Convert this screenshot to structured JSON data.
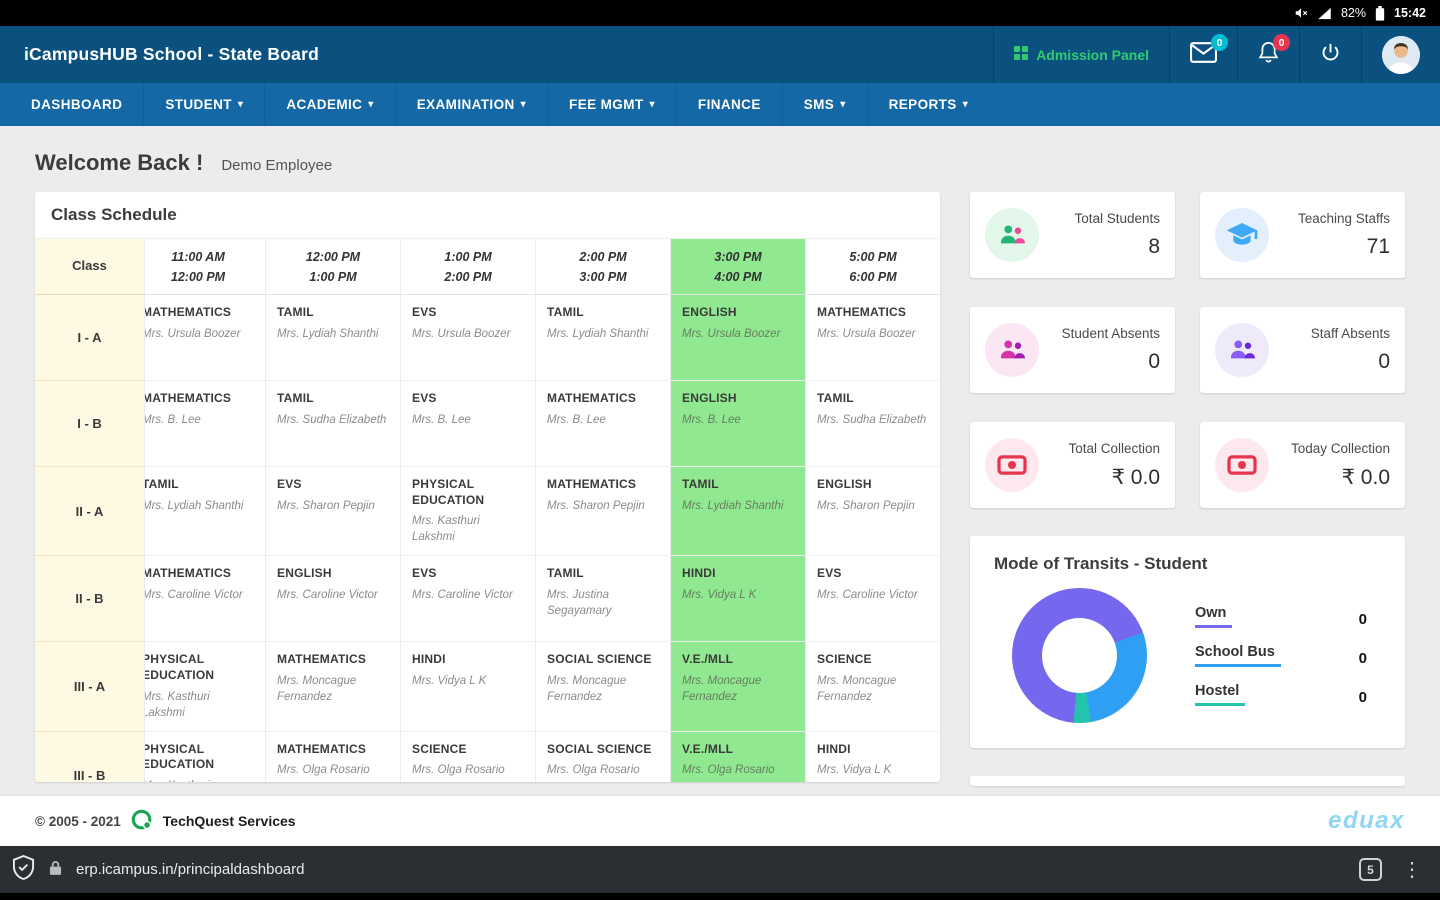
{
  "status_bar": {
    "battery": "82%",
    "time": "15:42"
  },
  "header": {
    "title": "iCampusHUB School - State Board",
    "admission_panel": "Admission Panel",
    "badges": {
      "messages": "0",
      "notifications": "0"
    },
    "accent_green": "#2ecc71"
  },
  "nav": {
    "items": [
      {
        "label": "DASHBOARD",
        "dropdown": false
      },
      {
        "label": "STUDENT",
        "dropdown": true
      },
      {
        "label": "ACADEMIC",
        "dropdown": true
      },
      {
        "label": "EXAMINATION",
        "dropdown": true
      },
      {
        "label": "FEE MGMT",
        "dropdown": true
      },
      {
        "label": "FINANCE",
        "dropdown": false
      },
      {
        "label": "SMS",
        "dropdown": true
      },
      {
        "label": "REPORTS",
        "dropdown": true
      }
    ]
  },
  "welcome": {
    "title": "Welcome Back !",
    "user": "Demo Employee"
  },
  "schedule": {
    "title": "Class Schedule",
    "class_header": "Class",
    "highlight_slot_index": 4,
    "highlight_color": "#90e890",
    "time_slots": [
      [
        "11:00 AM",
        "12:00 PM"
      ],
      [
        "12:00 PM",
        "1:00 PM"
      ],
      [
        "1:00 PM",
        "2:00 PM"
      ],
      [
        "2:00 PM",
        "3:00 PM"
      ],
      [
        "3:00 PM",
        "4:00 PM"
      ],
      [
        "5:00 PM",
        "6:00 PM"
      ]
    ],
    "rows": [
      {
        "class": "I - A",
        "periods": [
          {
            "subject": "MATHEMATICS",
            "teacher": "Mrs. Ursula Boozer"
          },
          {
            "subject": "TAMIL",
            "teacher": "Mrs. Lydiah Shanthi"
          },
          {
            "subject": "EVS",
            "teacher": "Mrs. Ursula Boozer"
          },
          {
            "subject": "TAMIL",
            "teacher": "Mrs. Lydiah Shanthi"
          },
          {
            "subject": "ENGLISH",
            "teacher": "Mrs. Ursula Boozer"
          },
          {
            "subject": "MATHEMATICS",
            "teacher": "Mrs. Ursula Boozer"
          }
        ]
      },
      {
        "class": "I - B",
        "periods": [
          {
            "subject": "MATHEMATICS",
            "teacher": "Mrs. B. Lee"
          },
          {
            "subject": "TAMIL",
            "teacher": "Mrs. Sudha Elizabeth"
          },
          {
            "subject": "EVS",
            "teacher": "Mrs. B. Lee"
          },
          {
            "subject": "MATHEMATICS",
            "teacher": "Mrs. B. Lee"
          },
          {
            "subject": "ENGLISH",
            "teacher": "Mrs. B. Lee"
          },
          {
            "subject": "TAMIL",
            "teacher": "Mrs. Sudha Elizabeth"
          }
        ]
      },
      {
        "class": "II - A",
        "periods": [
          {
            "subject": "TAMIL",
            "teacher": "Mrs. Lydiah Shanthi"
          },
          {
            "subject": "EVS",
            "teacher": "Mrs. Sharon Pepjin"
          },
          {
            "subject": "PHYSICAL EDUCATION",
            "teacher": "Mrs. Kasthuri Lakshmi"
          },
          {
            "subject": "MATHEMATICS",
            "teacher": "Mrs. Sharon Pepjin"
          },
          {
            "subject": "TAMIL",
            "teacher": "Mrs. Lydiah Shanthi"
          },
          {
            "subject": "ENGLISH",
            "teacher": "Mrs. Sharon Pepjin"
          }
        ]
      },
      {
        "class": "II - B",
        "periods": [
          {
            "subject": "MATHEMATICS",
            "teacher": "Mrs. Caroline Victor"
          },
          {
            "subject": "ENGLISH",
            "teacher": "Mrs. Caroline Victor"
          },
          {
            "subject": "EVS",
            "teacher": "Mrs. Caroline Victor"
          },
          {
            "subject": "TAMIL",
            "teacher": "Mrs. Justina Segayamary"
          },
          {
            "subject": "HINDI",
            "teacher": "Mrs. Vidya L K"
          },
          {
            "subject": "EVS",
            "teacher": "Mrs. Caroline Victor"
          }
        ]
      },
      {
        "class": "III - A",
        "periods": [
          {
            "subject": "PHYSICAL EDUCATION",
            "teacher": "Mrs. Kasthuri Lakshmi"
          },
          {
            "subject": "MATHEMATICS",
            "teacher": "Mrs. Moncague Fernandez"
          },
          {
            "subject": "HINDI",
            "teacher": "Mrs. Vidya L K"
          },
          {
            "subject": "SOCIAL SCIENCE",
            "teacher": "Mrs. Moncague Fernandez"
          },
          {
            "subject": "V.E./MLL",
            "teacher": "Mrs. Moncague Fernandez"
          },
          {
            "subject": "SCIENCE",
            "teacher": "Mrs. Moncague Fernandez"
          }
        ]
      },
      {
        "class": "III - B",
        "periods": [
          {
            "subject": "PHYSICAL EDUCATION",
            "teacher": "Mrs. Kasthuri Lakshmi"
          },
          {
            "subject": "MATHEMATICS",
            "teacher": "Mrs. Olga Rosario"
          },
          {
            "subject": "SCIENCE",
            "teacher": "Mrs. Olga Rosario"
          },
          {
            "subject": "SOCIAL SCIENCE",
            "teacher": "Mrs. Olga Rosario"
          },
          {
            "subject": "V.E./MLL",
            "teacher": "Mrs. Olga Rosario"
          },
          {
            "subject": "HINDI",
            "teacher": "Mrs. Vidya L K"
          }
        ]
      }
    ]
  },
  "stats": [
    {
      "label": "Total Students",
      "value": "8",
      "icon": "people-icon",
      "bg": "#e3f6ea",
      "c1": "#22b573",
      "c2": "#ec4899"
    },
    {
      "label": "Teaching Staffs",
      "value": "71",
      "icon": "graduation-cap-icon",
      "bg": "#e3f0fb",
      "c1": "#3fa9f5",
      "c2": "#3fa9f5"
    },
    {
      "label": "Student Absents",
      "value": "0",
      "icon": "people-icon",
      "bg": "#fbe7f3",
      "c1": "#d633a9",
      "c2": "#a21caf"
    },
    {
      "label": "Staff Absents",
      "value": "0",
      "icon": "people-icon",
      "bg": "#efeafa",
      "c1": "#8b5cf6",
      "c2": "#6d28d9"
    },
    {
      "label": "Total Collection",
      "value": "₹ 0.0",
      "icon": "banknote-icon",
      "bg": "#fde8ee",
      "c1": "#e8354f",
      "c2": "#e8354f"
    },
    {
      "label": "Today Collection",
      "value": "₹ 0.0",
      "icon": "banknote-icon",
      "bg": "#fde8ee",
      "c1": "#e8354f",
      "c2": "#e8354f"
    }
  ],
  "transit": {
    "title": "Mode of Transits - Student",
    "legend": [
      {
        "label": "Own",
        "value": "0",
        "color": "#7668ee"
      },
      {
        "label": "School Bus",
        "value": "0",
        "color": "#2e9ff2"
      },
      {
        "label": "Hostel",
        "value": "0",
        "color": "#23c3ae"
      }
    ],
    "donut_stops": [
      {
        "color": "#7668ee",
        "to": 70
      },
      {
        "color": "#2e9ff2",
        "to": 170
      },
      {
        "color": "#23c3ae",
        "to": 185
      },
      {
        "color": "#7668ee",
        "to": 360
      }
    ]
  },
  "chart_data": {
    "type": "pie",
    "title": "Mode of Transits - Student",
    "categories": [
      "Own",
      "School Bus",
      "Hostel"
    ],
    "values": [
      0,
      0,
      0
    ],
    "legend_position": "right"
  },
  "footer": {
    "copyright": "© 2005 - 2021",
    "company": "TechQuest Services",
    "brand": "eduax"
  },
  "browser": {
    "url": "erp.icampus.in/principaldashboard",
    "tab_count": "5"
  }
}
